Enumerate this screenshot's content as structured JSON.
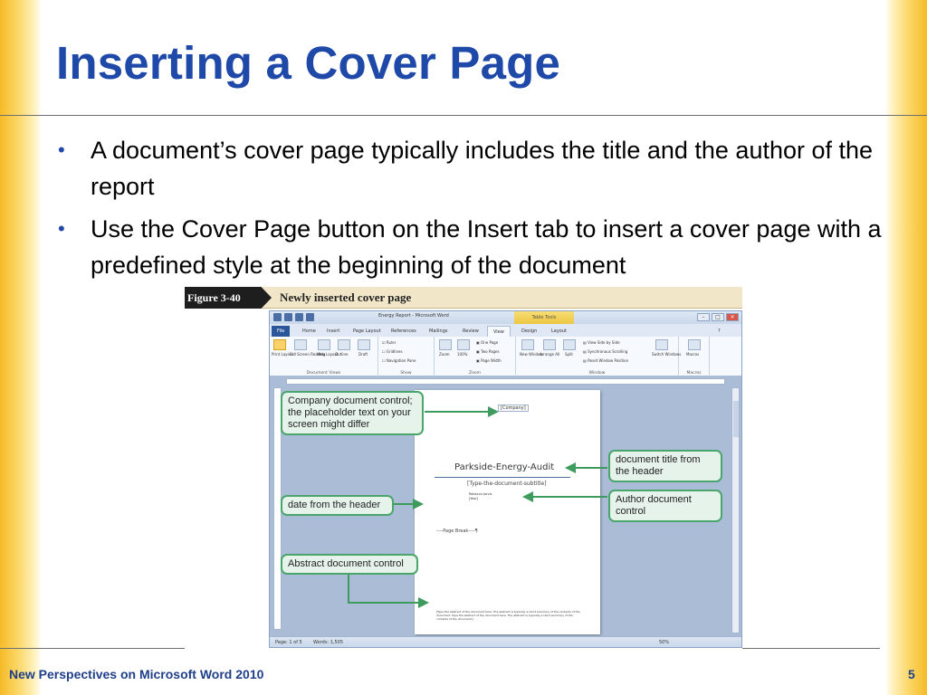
{
  "slide": {
    "title": "Inserting a Cover Page",
    "bullets": [
      "A document’s cover page typically includes the title and the author of the report",
      "Use the Cover Page button on the Insert tab to insert a cover page with a predefined style at the beginning of the document"
    ],
    "footer": "New Perspectives on Microsoft Word 2010",
    "page_number": "5"
  },
  "figure": {
    "number": "Figure 3-40",
    "caption": "Newly inserted cover page"
  },
  "word_window": {
    "title": "Energy Report - Microsoft Word",
    "contextual_tab": "Table Tools",
    "tabs": [
      "File",
      "Home",
      "Insert",
      "Page Layout",
      "References",
      "Mailings",
      "Review",
      "View",
      "Design",
      "Layout"
    ],
    "active_tab": "View",
    "ribbon": {
      "document_views": {
        "label": "Document Views",
        "buttons": [
          "Print Layout",
          "Full Screen Reading",
          "Web Layout",
          "Outline",
          "Draft"
        ]
      },
      "show": {
        "label": "Show",
        "options": [
          "Ruler",
          "Gridlines",
          "Navigation Pane"
        ]
      },
      "zoom": {
        "label": "Zoom",
        "buttons": [
          "Zoom",
          "100%",
          "One Page",
          "Two Pages",
          "Page Width"
        ]
      },
      "window": {
        "label": "Window",
        "buttons": [
          "New Window",
          "Arrange All",
          "Split",
          "View Side by Side",
          "Synchronous Scrolling",
          "Reset Window Position",
          "Switch Windows"
        ]
      },
      "macros": {
        "label": "Macros",
        "buttons": [
          "Macros"
        ]
      }
    },
    "document": {
      "company_placeholder": "[Company]",
      "title": "Parkside-Energy-Audit",
      "subtitle": "[Type-the-document-subtitle]",
      "author_date": "Rebecca Jarvis\n[Year]",
      "page_break": "Page Break",
      "abstract": "[Type the abstract of the document here. The abstract is typically a short summary of the contents of the document. Type the abstract of the document here. The abstract is typically a short summary of the contents of the document.]"
    },
    "status": {
      "page": "Page: 1 of 5",
      "words": "Words: 1,505",
      "zoom": "50%"
    }
  },
  "callouts": {
    "company": "Company document control; the placeholder text on your screen might differ",
    "title": "document title from the header",
    "date": "date from the header",
    "author": "Author document control",
    "abstract": "Abstract document control"
  },
  "colors": {
    "title_blue": "#1f49a8",
    "gold_accent": "#f6bb27",
    "callout_border": "#4aa56c"
  }
}
